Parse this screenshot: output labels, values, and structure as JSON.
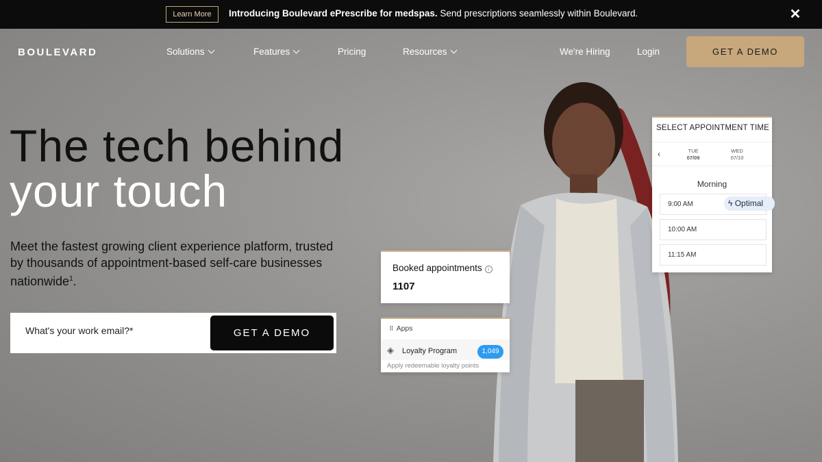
{
  "announcement": {
    "learn_more": "Learn More",
    "title": "Introducing Boulevard ePrescribe for medspas.",
    "text": " Send prescriptions seamlessly within Boulevard.",
    "close": "✕"
  },
  "nav": {
    "logo": "BOULEVARD",
    "items": [
      {
        "label": "Solutions"
      },
      {
        "label": "Features"
      },
      {
        "label": "Pricing"
      },
      {
        "label": "Resources"
      }
    ],
    "hiring": "We're Hiring",
    "login": "Login",
    "cta": "GET A DEMO"
  },
  "hero": {
    "line1": "The tech behind",
    "line2": "your touch",
    "sub": "Meet the fastest growing client experience platform, trusted by thousands of appointment-based self-care businesses nationwide",
    "sub_sup": "1",
    "sub_end": ".",
    "email_placeholder": "What's your work email?*",
    "cta": "GET A DEMO"
  },
  "booked_card": {
    "title": "Booked appointments",
    "info_icon": "i",
    "value": "1107"
  },
  "apps_card": {
    "header": "Apps",
    "program": "Loyalty Program",
    "badge": "1,049",
    "desc": "Apply redeemable loyalty points"
  },
  "appointment_card": {
    "header": "SELECT APPOINTMENT TIME",
    "days": [
      {
        "dow": "TUE",
        "date": "07/09"
      },
      {
        "dow": "WED",
        "date": "07/10"
      }
    ],
    "period": "Morning",
    "slots": [
      "9:00 AM",
      "10:00 AM",
      "11:15 AM"
    ],
    "optimal": "Optimal"
  }
}
